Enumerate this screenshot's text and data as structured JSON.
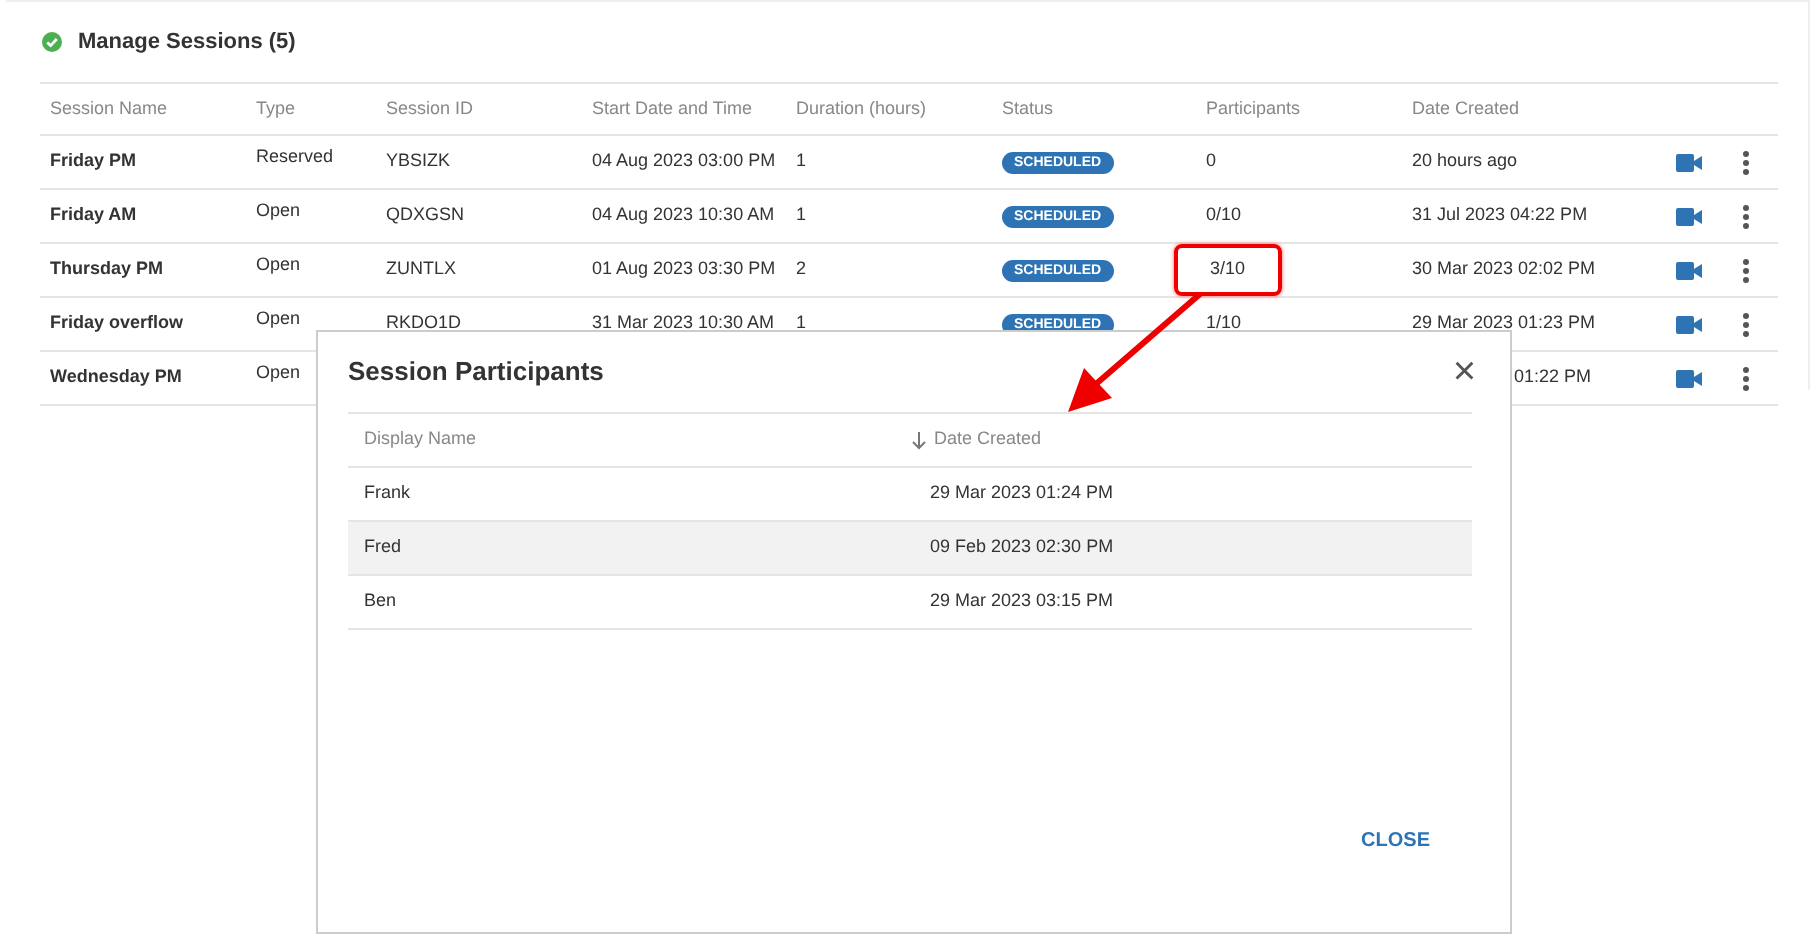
{
  "title": "Manage Sessions (5)",
  "columns": [
    "Session Name",
    "Type",
    "Session ID",
    "Start Date and Time",
    "Duration (hours)",
    "Status",
    "Participants",
    "Date Created"
  ],
  "rows": [
    {
      "name": "Friday PM",
      "type": "Reserved",
      "session_id": "YBSIZK",
      "start": "04 Aug 2023 03:00 PM",
      "duration": "1",
      "status": "SCHEDULED",
      "participants": "0",
      "created": "20 hours ago",
      "circled": false
    },
    {
      "name": "Friday AM",
      "type": "Open",
      "session_id": "QDXGSN",
      "start": "04 Aug 2023 10:30 AM",
      "duration": "1",
      "status": "SCHEDULED",
      "participants": "0/10",
      "created": "31 Jul 2023 04:22 PM",
      "circled": false
    },
    {
      "name": "Thursday PM",
      "type": "Open",
      "session_id": "ZUNTLX",
      "start": "01 Aug 2023 03:30 PM",
      "duration": "2",
      "status": "SCHEDULED",
      "participants": "3/10",
      "created": "30 Mar 2023 02:02 PM",
      "circled": true
    },
    {
      "name": "Friday overflow",
      "type": "Open",
      "session_id": "RKDO1D",
      "start": "31 Mar 2023 10:30 AM",
      "duration": "1",
      "status": "SCHEDULED",
      "participants": "1/10",
      "created": "29 Mar 2023 01:23 PM",
      "circled": false
    },
    {
      "name": "Wednesday PM",
      "type": "Open",
      "created": "01:22 PM"
    }
  ],
  "dialog": {
    "title": "Session Participants",
    "close_icon": "×",
    "columns": [
      "Display Name",
      "Date Created"
    ],
    "rows": [
      {
        "name": "Frank",
        "created": "29 Mar 2023 01:24 PM",
        "highlighted": false
      },
      {
        "name": "Fred",
        "created": "09 Feb 2023 02:30 PM",
        "highlighted": true
      },
      {
        "name": "Ben",
        "created": "29 Mar 2023 03:15 PM",
        "highlighted": false
      }
    ],
    "button": "CLOSE"
  }
}
